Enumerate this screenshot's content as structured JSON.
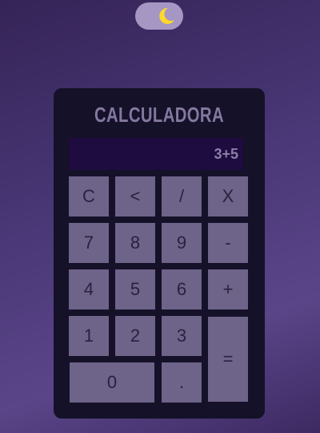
{
  "theme_toggle": {
    "icon": "moon-icon",
    "icon_color": "#ffd92a"
  },
  "calculator": {
    "title": "CALCULADORA",
    "display": "3+5",
    "keys": {
      "clear": "C",
      "backspace": "<",
      "divide": "/",
      "multiply": "X",
      "seven": "7",
      "eight": "8",
      "nine": "9",
      "minus": "-",
      "four": "4",
      "five": "5",
      "six": "6",
      "plus": "+",
      "one": "1",
      "two": "2",
      "three": "3",
      "equals": "=",
      "zero": "0",
      "decimal": "."
    }
  },
  "colors": {
    "background": "#4a3878",
    "panel": "#151129",
    "display_bg": "#1e0c40",
    "key": "#6e6388",
    "toggle": "#a596c4"
  }
}
